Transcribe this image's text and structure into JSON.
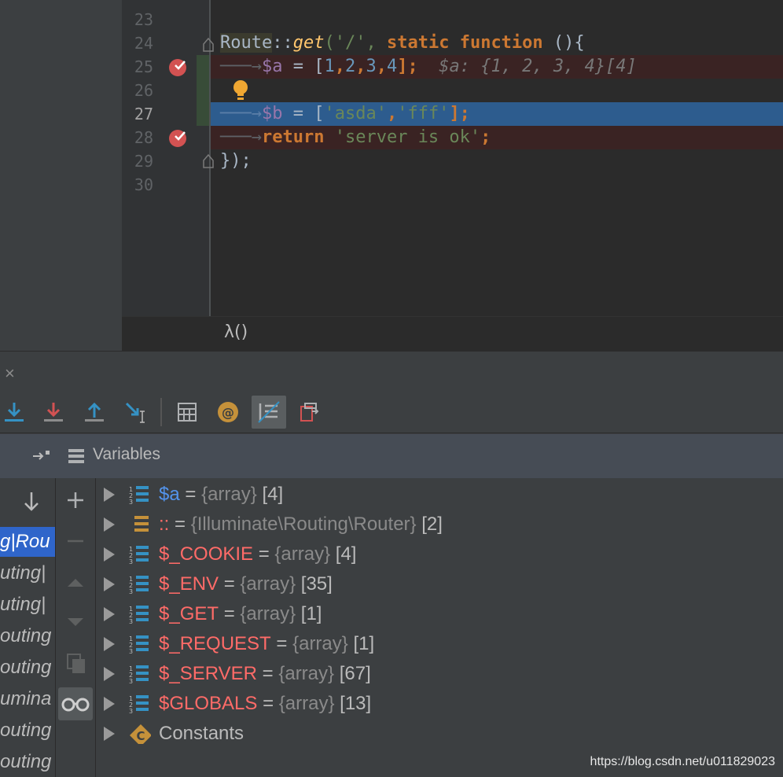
{
  "editor": {
    "line_numbers": [
      "23",
      "24",
      "25",
      "26",
      "27",
      "28",
      "29",
      "30"
    ],
    "lines": {
      "l24": {
        "cls": "Route",
        "sep": "::",
        "fn": "get",
        "p1": "('/', ",
        "kw1": "static",
        "kw2": "function",
        "tail": " (){"
      },
      "l25": {
        "var": "$a",
        "eq": " = [",
        "n1": "1",
        ",1": ",",
        "n2": "2",
        ",2": ",",
        "n3": "3",
        ",3": ",",
        "n4": "4",
        "end": "];",
        "hint": "$a: {1, 2, 3, 4}[4]"
      },
      "l27": {
        "var": "$b",
        "eq": " = [",
        "s1": "'asda'",
        "c": ",",
        "s2": "'fff'",
        "end": "];"
      },
      "l28": {
        "kw": "return",
        "str": "'server is ok'",
        "end": ";"
      },
      "l29": {
        "text": "});"
      }
    },
    "breadcrumb": "λ()"
  },
  "debug": {
    "close_glyph": "×",
    "variables_title": "Variables",
    "frames": [
      "g|Rou",
      "uting|",
      "uting|",
      "outing",
      "outing",
      "umina",
      "outing",
      "outing"
    ],
    "variables": [
      {
        "name": "$a",
        "eq": " = ",
        "type": "{array}",
        "count": " [4]",
        "style": "blue",
        "icon": "array-icon"
      },
      {
        "name": "::",
        "eq": " = ",
        "type": "{Illuminate\\Routing\\Router}",
        "count": " [2]",
        "style": "red",
        "icon": "object-icon"
      },
      {
        "name": "$_COOKIE",
        "eq": " = ",
        "type": "{array}",
        "count": " [4]",
        "style": "red",
        "icon": "array-icon"
      },
      {
        "name": "$_ENV",
        "eq": " = ",
        "type": "{array}",
        "count": " [35]",
        "style": "red",
        "icon": "array-icon"
      },
      {
        "name": "$_GET",
        "eq": " = ",
        "type": "{array}",
        "count": " [1]",
        "style": "red",
        "icon": "array-icon"
      },
      {
        "name": "$_REQUEST",
        "eq": " = ",
        "type": "{array}",
        "count": " [1]",
        "style": "red",
        "icon": "array-icon"
      },
      {
        "name": "$_SERVER",
        "eq": " = ",
        "type": "{array}",
        "count": " [67]",
        "style": "red",
        "icon": "array-icon"
      },
      {
        "name": "$GLOBALS",
        "eq": " = ",
        "type": "{array}",
        "count": " [13]",
        "style": "red",
        "icon": "array-icon"
      },
      {
        "name": "Constants",
        "eq": "",
        "type": "",
        "count": "",
        "style": "plain",
        "icon": "constants-icon"
      }
    ],
    "watermark": "https://blog.csdn.net/u011829023"
  },
  "colors": {
    "background": "#3c3f41",
    "editor_bg": "#2b2b2b",
    "selection": "#2d5c8e",
    "breakpoint": "#d25252",
    "var_red": "#ff6b68",
    "var_blue": "#5394ec"
  }
}
